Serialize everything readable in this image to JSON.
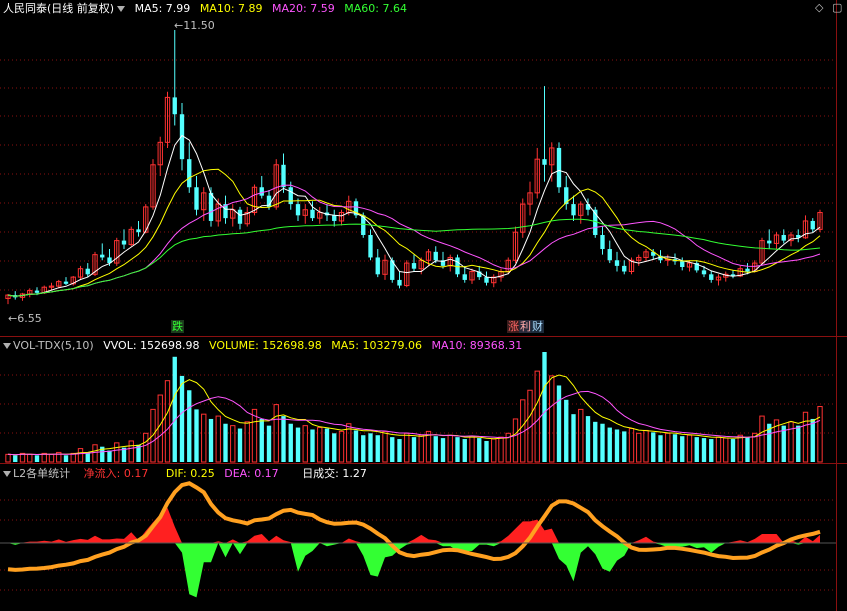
{
  "colors": {
    "up": "#ff3232",
    "down": "#54ffff",
    "ma5": "#ffffff",
    "ma10": "#ffff00",
    "ma20": "#ff55ff",
    "ma60": "#33ff33",
    "grid": "#8a1010",
    "label": "#c0c0c0"
  },
  "main": {
    "title": "人民同泰(日线 前复权)",
    "ma5": "MA5: 7.99",
    "ma10": "MA10: 7.89",
    "ma20": "MA20: 7.59",
    "ma60": "MA60: 7.64",
    "high_label": "11.50",
    "low_label": "6.55",
    "tags": [
      {
        "text": "跌",
        "color": "#33ff33",
        "bg": "#224422"
      },
      {
        "text": "涨",
        "color": "#ff6666",
        "bg": "#442222"
      },
      {
        "text": "利",
        "color": "#ffaaaa",
        "bg": "#333344"
      },
      {
        "text": "财",
        "color": "#aaddff",
        "bg": "#223344"
      }
    ]
  },
  "vol": {
    "title": "VOL-TDX(5,10)",
    "vvol": "VVOL: 152698.98",
    "volume": "VOLUME: 152698.98",
    "ma5": "MA5: 103279.06",
    "ma10": "MA10: 89368.31"
  },
  "l2": {
    "title": "L2各单统计",
    "net": "净流入: 0.17",
    "dif": "DIF: 0.25",
    "dea": "DEA: 0.17",
    "daily": "日成交: 1.27"
  },
  "chart_data": {
    "type": "candlestick",
    "price_range": [
      6.55,
      11.5
    ],
    "candles": [
      [
        6.72,
        6.8,
        6.62,
        6.78
      ],
      [
        6.78,
        6.85,
        6.7,
        6.74
      ],
      [
        6.74,
        6.82,
        6.68,
        6.8
      ],
      [
        6.8,
        6.9,
        6.74,
        6.86
      ],
      [
        6.86,
        6.92,
        6.78,
        6.82
      ],
      [
        6.82,
        6.95,
        6.8,
        6.92
      ],
      [
        6.92,
        7.0,
        6.86,
        6.94
      ],
      [
        6.94,
        7.05,
        6.9,
        7.02
      ],
      [
        7.02,
        7.1,
        6.96,
        6.98
      ],
      [
        6.98,
        7.12,
        6.95,
        7.1
      ],
      [
        7.1,
        7.3,
        7.05,
        7.25
      ],
      [
        7.25,
        7.35,
        7.1,
        7.15
      ],
      [
        7.15,
        7.55,
        7.12,
        7.5
      ],
      [
        7.5,
        7.7,
        7.4,
        7.45
      ],
      [
        7.45,
        7.6,
        7.3,
        7.35
      ],
      [
        7.35,
        7.8,
        7.3,
        7.75
      ],
      [
        7.75,
        7.95,
        7.6,
        7.68
      ],
      [
        7.68,
        8.0,
        7.65,
        7.95
      ],
      [
        7.95,
        8.1,
        7.82,
        7.9
      ],
      [
        7.9,
        8.4,
        7.88,
        8.35
      ],
      [
        8.35,
        9.2,
        8.3,
        9.1
      ],
      [
        9.1,
        9.6,
        8.9,
        9.5
      ],
      [
        9.5,
        10.4,
        9.4,
        10.3
      ],
      [
        10.3,
        11.5,
        9.8,
        10.0
      ],
      [
        10.0,
        10.2,
        9.0,
        9.2
      ],
      [
        9.2,
        9.5,
        8.6,
        8.7
      ],
      [
        8.7,
        8.9,
        8.2,
        8.3
      ],
      [
        8.3,
        8.7,
        8.1,
        8.6
      ],
      [
        8.6,
        8.7,
        8.0,
        8.1
      ],
      [
        8.1,
        8.5,
        8.0,
        8.4
      ],
      [
        8.4,
        8.55,
        8.05,
        8.15
      ],
      [
        8.15,
        8.4,
        8.0,
        8.3
      ],
      [
        8.3,
        8.35,
        7.95,
        8.05
      ],
      [
        8.05,
        8.35,
        8.0,
        8.25
      ],
      [
        8.25,
        8.75,
        8.2,
        8.7
      ],
      [
        8.7,
        8.9,
        8.5,
        8.55
      ],
      [
        8.55,
        8.65,
        8.3,
        8.35
      ],
      [
        8.35,
        9.2,
        8.3,
        9.1
      ],
      [
        9.1,
        9.3,
        8.6,
        8.7
      ],
      [
        8.7,
        8.8,
        8.3,
        8.4
      ],
      [
        8.4,
        8.5,
        8.1,
        8.2
      ],
      [
        8.2,
        8.4,
        8.05,
        8.3
      ],
      [
        8.3,
        8.45,
        8.1,
        8.15
      ],
      [
        8.15,
        8.35,
        8.05,
        8.25
      ],
      [
        8.25,
        8.4,
        8.1,
        8.2
      ],
      [
        8.2,
        8.3,
        8.0,
        8.1
      ],
      [
        8.1,
        8.3,
        8.02,
        8.25
      ],
      [
        8.25,
        8.55,
        8.2,
        8.45
      ],
      [
        8.45,
        8.5,
        8.15,
        8.2
      ],
      [
        8.2,
        8.25,
        7.8,
        7.85
      ],
      [
        7.85,
        7.95,
        7.4,
        7.45
      ],
      [
        7.45,
        7.6,
        7.1,
        7.15
      ],
      [
        7.15,
        7.5,
        7.05,
        7.4
      ],
      [
        7.4,
        7.45,
        7.0,
        7.05
      ],
      [
        7.05,
        7.2,
        6.9,
        6.95
      ],
      [
        6.95,
        7.4,
        6.92,
        7.35
      ],
      [
        7.35,
        7.5,
        7.2,
        7.25
      ],
      [
        7.25,
        7.45,
        7.15,
        7.4
      ],
      [
        7.4,
        7.6,
        7.3,
        7.55
      ],
      [
        7.55,
        7.65,
        7.35,
        7.4
      ],
      [
        7.4,
        7.55,
        7.25,
        7.3
      ],
      [
        7.3,
        7.5,
        7.2,
        7.45
      ],
      [
        7.45,
        7.5,
        7.1,
        7.15
      ],
      [
        7.15,
        7.3,
        7.0,
        7.05
      ],
      [
        7.05,
        7.25,
        6.98,
        7.2
      ],
      [
        7.2,
        7.3,
        7.05,
        7.1
      ],
      [
        7.1,
        7.2,
        6.95,
        7.0
      ],
      [
        7.0,
        7.15,
        6.92,
        7.1
      ],
      [
        7.1,
        7.25,
        7.02,
        7.2
      ],
      [
        7.2,
        7.45,
        7.15,
        7.4
      ],
      [
        7.4,
        8.0,
        7.35,
        7.9
      ],
      [
        7.9,
        8.5,
        7.8,
        8.4
      ],
      [
        8.4,
        8.8,
        8.2,
        8.6
      ],
      [
        8.6,
        9.4,
        8.5,
        9.2
      ],
      [
        9.2,
        10.5,
        8.8,
        9.1
      ],
      [
        9.1,
        9.5,
        8.8,
        9.4
      ],
      [
        9.4,
        9.5,
        8.6,
        8.7
      ],
      [
        8.7,
        8.9,
        8.3,
        8.4
      ],
      [
        8.4,
        8.55,
        8.1,
        8.2
      ],
      [
        8.2,
        8.45,
        8.05,
        8.4
      ],
      [
        8.4,
        8.5,
        8.2,
        8.3
      ],
      [
        8.3,
        8.35,
        7.8,
        7.85
      ],
      [
        7.85,
        8.0,
        7.5,
        7.6
      ],
      [
        7.6,
        7.75,
        7.35,
        7.4
      ],
      [
        7.4,
        7.55,
        7.2,
        7.3
      ],
      [
        7.3,
        7.4,
        7.15,
        7.2
      ],
      [
        7.2,
        7.45,
        7.15,
        7.4
      ],
      [
        7.4,
        7.5,
        7.3,
        7.45
      ],
      [
        7.45,
        7.6,
        7.38,
        7.55
      ],
      [
        7.55,
        7.6,
        7.42,
        7.48
      ],
      [
        7.48,
        7.58,
        7.35,
        7.4
      ],
      [
        7.4,
        7.5,
        7.3,
        7.42
      ],
      [
        7.42,
        7.52,
        7.32,
        7.38
      ],
      [
        7.38,
        7.45,
        7.22,
        7.28
      ],
      [
        7.28,
        7.4,
        7.2,
        7.35
      ],
      [
        7.35,
        7.4,
        7.18,
        7.22
      ],
      [
        7.22,
        7.3,
        7.1,
        7.15
      ],
      [
        7.15,
        7.22,
        7.0,
        7.05
      ],
      [
        7.05,
        7.15,
        6.95,
        7.1
      ],
      [
        7.1,
        7.2,
        7.02,
        7.15
      ],
      [
        7.15,
        7.22,
        7.08,
        7.12
      ],
      [
        7.12,
        7.3,
        7.1,
        7.25
      ],
      [
        7.25,
        7.35,
        7.15,
        7.2
      ],
      [
        7.2,
        7.4,
        7.18,
        7.35
      ],
      [
        7.35,
        7.8,
        7.32,
        7.75
      ],
      [
        7.75,
        7.95,
        7.6,
        7.7
      ],
      [
        7.7,
        7.9,
        7.6,
        7.85
      ],
      [
        7.85,
        7.95,
        7.7,
        7.75
      ],
      [
        7.75,
        7.9,
        7.65,
        7.85
      ],
      [
        7.85,
        7.95,
        7.72,
        7.8
      ],
      [
        7.8,
        8.2,
        7.78,
        8.1
      ],
      [
        8.1,
        8.15,
        7.9,
        7.95
      ],
      [
        7.95,
        8.3,
        7.9,
        8.25
      ]
    ],
    "volumes": [
      8,
      7,
      9,
      8,
      7,
      9,
      8,
      10,
      7,
      9,
      14,
      10,
      18,
      16,
      12,
      20,
      15,
      22,
      18,
      30,
      55,
      70,
      85,
      110,
      90,
      75,
      55,
      50,
      45,
      48,
      40,
      38,
      35,
      42,
      55,
      45,
      38,
      60,
      48,
      40,
      36,
      38,
      34,
      36,
      35,
      30,
      32,
      40,
      33,
      28,
      30,
      28,
      32,
      26,
      24,
      30,
      26,
      28,
      32,
      27,
      25,
      28,
      26,
      24,
      27,
      25,
      22,
      24,
      26,
      30,
      45,
      65,
      75,
      95,
      115,
      90,
      80,
      65,
      50,
      55,
      48,
      42,
      40,
      36,
      34,
      32,
      35,
      30,
      33,
      31,
      28,
      30,
      29,
      27,
      28,
      26,
      25,
      24,
      26,
      25,
      24,
      28,
      26,
      30,
      48,
      40,
      44,
      38,
      42,
      38,
      52,
      45,
      58
    ]
  }
}
